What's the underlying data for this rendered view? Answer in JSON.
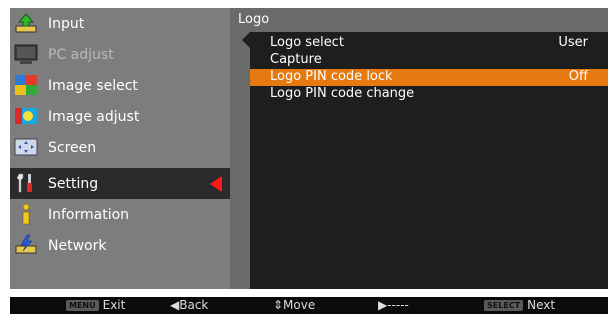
{
  "menu": {
    "items": [
      {
        "label": "Input",
        "icon": "input-icon"
      },
      {
        "label": "PC adjust",
        "icon": "pc-adjust-icon",
        "disabled": true
      },
      {
        "label": "Image select",
        "icon": "image-select-icon"
      },
      {
        "label": "Image adjust",
        "icon": "image-adjust-icon"
      },
      {
        "label": "Screen",
        "icon": "screen-icon"
      },
      {
        "label": "Setting",
        "icon": "setting-icon",
        "selected": true
      },
      {
        "label": "Information",
        "icon": "information-icon"
      },
      {
        "label": "Network",
        "icon": "network-icon"
      }
    ]
  },
  "submenu": {
    "title": "Logo",
    "rows": [
      {
        "label": "Logo select",
        "value": "User"
      },
      {
        "label": "Capture",
        "value": ""
      },
      {
        "label": "Logo PIN code lock",
        "value": "Off",
        "selected": true
      },
      {
        "label": "Logo PIN code change",
        "value": ""
      }
    ]
  },
  "footer": {
    "exit_key": "MENU",
    "exit_label": "Exit",
    "back_label": "◀Back",
    "move_label": "⇕Move",
    "next_arrow_label": "▶-----",
    "select_key": "SELECT",
    "next_label": "Next"
  },
  "colors": {
    "highlight": "#e57a10",
    "selection_arrow": "#ff1a1a",
    "panel_bg": "#7d7d7d",
    "submenu_bg": "#1e1e1e"
  }
}
